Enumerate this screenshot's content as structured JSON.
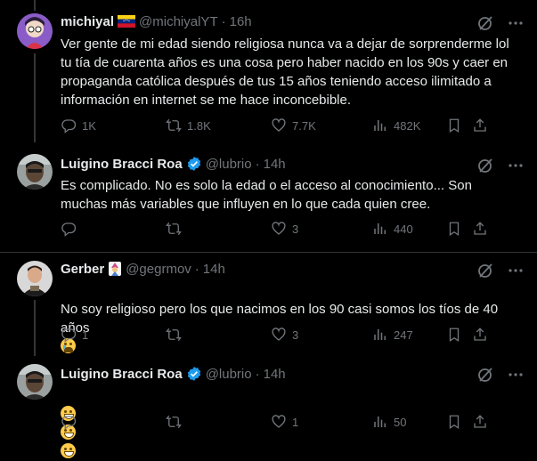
{
  "tweets": [
    {
      "name": "michiyal",
      "handle": "@michiyalYT",
      "dot": "·",
      "time": "16h",
      "text": "Ver gente de mi edad siendo religiosa nunca va a dejar de sorprenderme lol\ntu tía de cuarenta años es una cosa pero haber nacido en los 90s y caer en\npropaganda católica después de tus 15 años teniendo acceso ilimitado a\ninformación en internet se me hace inconcebible.",
      "replies": "1K",
      "retweets": "1.8K",
      "likes": "7.7K",
      "views": "482K"
    },
    {
      "name": "Luigino Bracci Roa",
      "handle": "@lubrio",
      "dot": "·",
      "time": "14h",
      "text": "Es complicado. No es solo la edad o el acceso al conocimiento... Son\nmuchas más variables que influyen en lo que cada quien cree.",
      "replies": "",
      "retweets": "",
      "likes": "3",
      "views": "440"
    },
    {
      "name": "Gerber",
      "handle": "@gegrmov",
      "dot": "·",
      "time": "14h",
      "text": "No soy religioso pero los que nacimos en los 90 casi somos los tíos de 40\naños",
      "replies": "1",
      "retweets": "",
      "likes": "3",
      "views": "247"
    },
    {
      "name": "Luigino Bracci Roa",
      "handle": "@lubrio",
      "dot": "·",
      "time": "14h",
      "text": "",
      "replies": "",
      "retweets": "",
      "likes": "1",
      "views": "50"
    }
  ],
  "colors": {
    "background": "#000000",
    "text": "#e7e9ea",
    "muted": "#71767b",
    "verified": "#1d9bf0",
    "divider": "#2f3336"
  }
}
